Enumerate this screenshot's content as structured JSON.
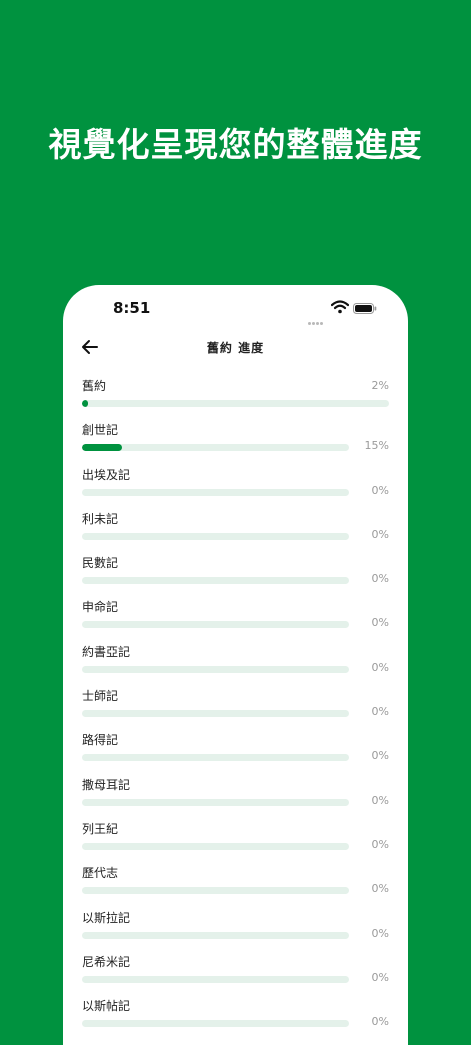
{
  "headline": "視覺化呈現您的整體進度",
  "status_bar": {
    "time": "8:51"
  },
  "nav": {
    "title": "舊約 進度"
  },
  "colors": {
    "accent": "#00923f",
    "track": "#e4f1ea",
    "text": "#222222",
    "muted": "#9a9a9a"
  },
  "books": [
    {
      "name": "舊約",
      "percent_label": "2%",
      "progress": 0.02
    },
    {
      "name": "創世記",
      "percent_label": "15%",
      "progress": 0.15
    },
    {
      "name": "出埃及記",
      "percent_label": "0%",
      "progress": 0
    },
    {
      "name": "利未記",
      "percent_label": "0%",
      "progress": 0
    },
    {
      "name": "民數記",
      "percent_label": "0%",
      "progress": 0
    },
    {
      "name": "申命記",
      "percent_label": "0%",
      "progress": 0
    },
    {
      "name": "約書亞記",
      "percent_label": "0%",
      "progress": 0
    },
    {
      "name": "士師記",
      "percent_label": "0%",
      "progress": 0
    },
    {
      "name": "路得記",
      "percent_label": "0%",
      "progress": 0
    },
    {
      "name": "撒母耳記",
      "percent_label": "0%",
      "progress": 0
    },
    {
      "name": "列王紀",
      "percent_label": "0%",
      "progress": 0
    },
    {
      "name": "歷代志",
      "percent_label": "0%",
      "progress": 0
    },
    {
      "name": "以斯拉記",
      "percent_label": "0%",
      "progress": 0
    },
    {
      "name": "尼希米記",
      "percent_label": "0%",
      "progress": 0
    },
    {
      "name": "以斯帖記",
      "percent_label": "0%",
      "progress": 0
    }
  ]
}
